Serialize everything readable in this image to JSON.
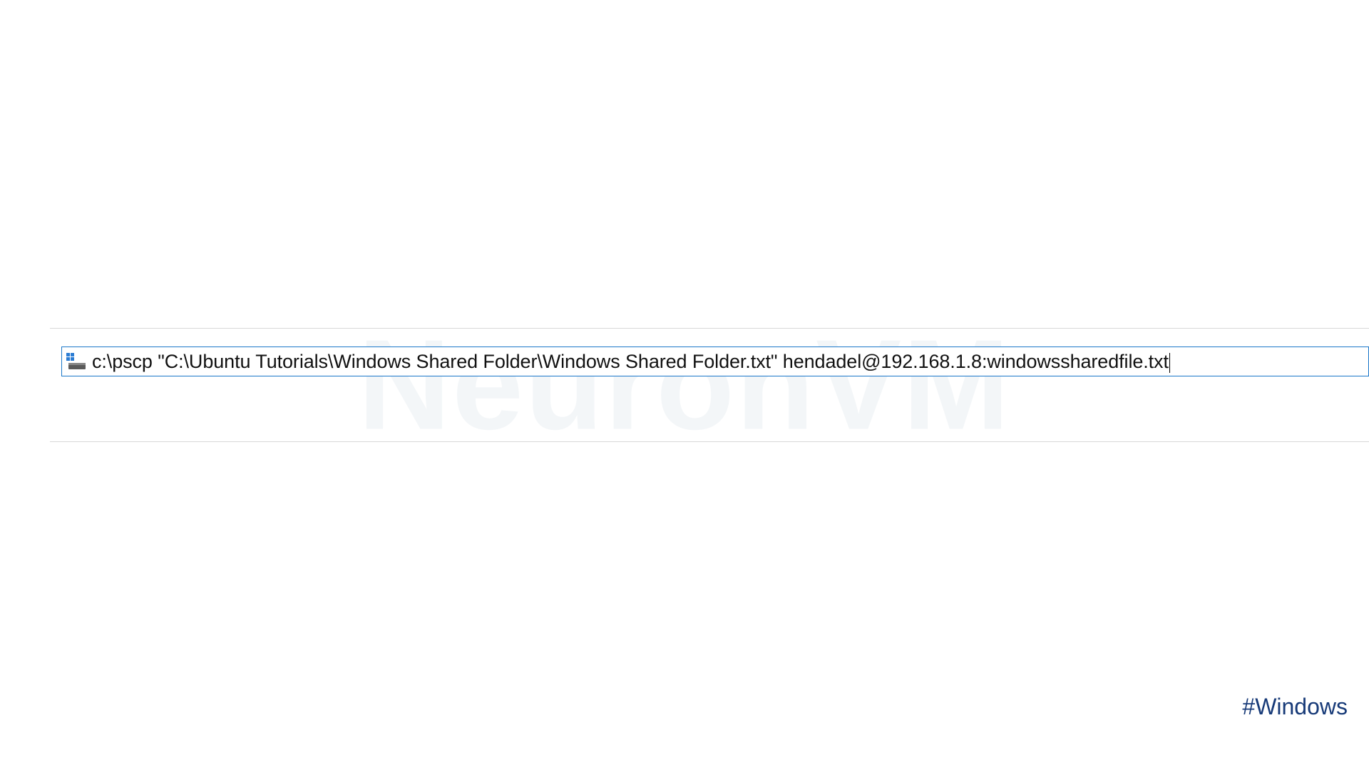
{
  "watermark": "NeuronVM",
  "runDialog": {
    "command": "c:\\pscp \"C:\\Ubuntu Tutorials\\Windows Shared Folder\\Windows Shared Folder.txt\" hendadel@192.168.1.8:windowssharedfile.txt"
  },
  "hashtag": "#Windows"
}
